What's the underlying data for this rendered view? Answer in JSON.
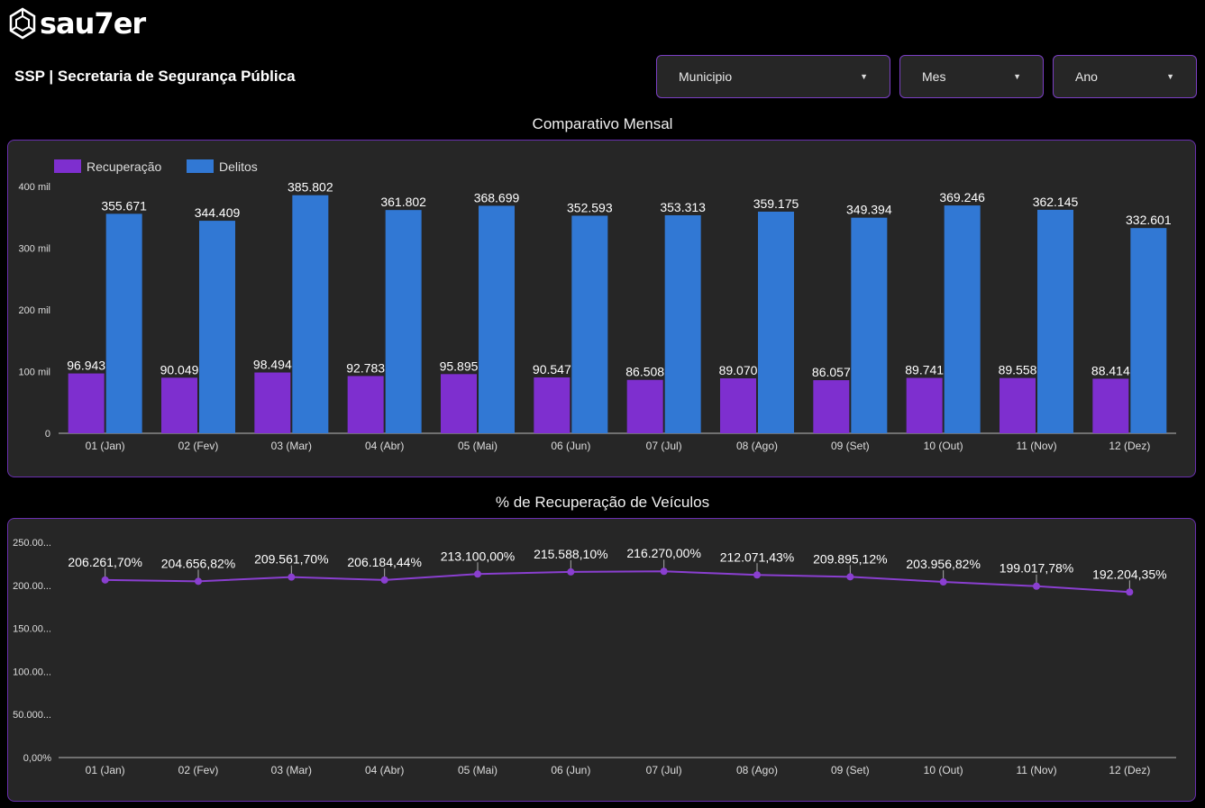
{
  "brand": {
    "name": "sau7er"
  },
  "header": {
    "title": "SSP | Secretaria de Segurança Pública"
  },
  "filters": [
    {
      "label": "Municipio"
    },
    {
      "label": "Mes"
    },
    {
      "label": "Ano"
    }
  ],
  "colors": {
    "recuperacao": "#7e2fcf",
    "delitos": "#3178d4",
    "panel_border": "#6a2fb0",
    "line": "#8a3fd0"
  },
  "chart_data": [
    {
      "type": "bar",
      "title": "Comparativo Mensal",
      "categories": [
        "01 (Jan)",
        "02 (Fev)",
        "03 (Mar)",
        "04 (Abr)",
        "05 (Mai)",
        "06 (Jun)",
        "07 (Jul)",
        "08 (Ago)",
        "09 (Set)",
        "10 (Out)",
        "11 (Nov)",
        "12 (Dez)"
      ],
      "series": [
        {
          "name": "Recuperação",
          "values": [
            96943,
            90049,
            98494,
            92783,
            95895,
            90547,
            86508,
            89070,
            86057,
            89741,
            89558,
            88414
          ],
          "labels": [
            "96.943",
            "90.049",
            "98.494",
            "92.783",
            "95.895",
            "90.547",
            "86.508",
            "89.070",
            "86.057",
            "89.741",
            "89.558",
            "88.414"
          ]
        },
        {
          "name": "Delitos",
          "values": [
            355671,
            344409,
            385802,
            361802,
            368699,
            352593,
            353313,
            359175,
            349394,
            369246,
            362145,
            332601
          ],
          "labels": [
            "355.671",
            "344.409",
            "385.802",
            "361.802",
            "368.699",
            "352.593",
            "353.313",
            "359.175",
            "349.394",
            "369.246",
            "362.145",
            "332.601"
          ]
        }
      ],
      "ylim": [
        0,
        400000
      ],
      "yticks": [
        0,
        100000,
        200000,
        300000,
        400000
      ],
      "ytick_labels": [
        "0",
        "100 mil",
        "200 mil",
        "300 mil",
        "400 mil"
      ],
      "legend": "top-left",
      "grid": false
    },
    {
      "type": "line",
      "title": "% de Recuperação de Veículos",
      "categories": [
        "01 (Jan)",
        "02 (Fev)",
        "03 (Mar)",
        "04 (Abr)",
        "05 (Mai)",
        "06 (Jun)",
        "07 (Jul)",
        "08 (Ago)",
        "09 (Set)",
        "10 (Out)",
        "11 (Nov)",
        "12 (Dez)"
      ],
      "values": [
        206261.7,
        204656.82,
        209561.7,
        206184.44,
        213100.0,
        215588.1,
        216270.0,
        212071.43,
        209895.12,
        203956.82,
        199017.78,
        192204.35
      ],
      "labels": [
        "206.261,70%",
        "204.656,82%",
        "209.561,70%",
        "206.184,44%",
        "213.100,00%",
        "215.588,10%",
        "216.270,00%",
        "212.071,43%",
        "209.895,12%",
        "203.956,82%",
        "199.017,78%",
        "192.204,35%"
      ],
      "ylim": [
        0,
        250000
      ],
      "yticks": [
        0,
        50000,
        100000,
        150000,
        200000,
        250000
      ],
      "ytick_labels": [
        "0,00%",
        "50.000...",
        "100.00...",
        "150.00...",
        "200.00...",
        "250.00..."
      ],
      "grid": false
    }
  ]
}
